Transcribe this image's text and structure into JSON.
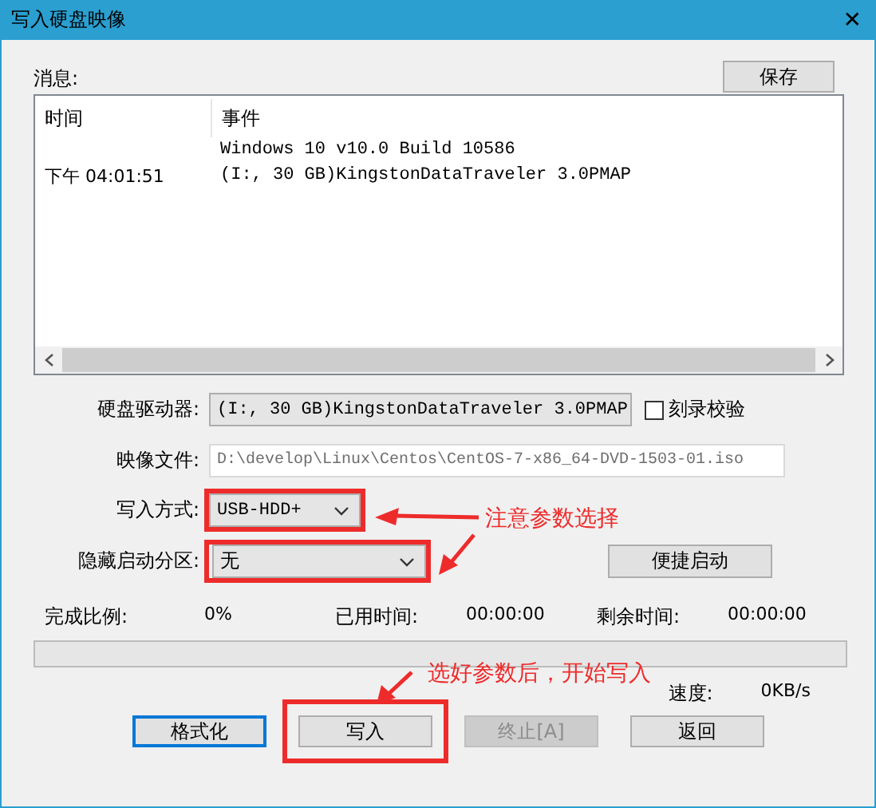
{
  "window": {
    "title": "写入硬盘映像",
    "close": "✕"
  },
  "messages": {
    "label": "消息:",
    "save_button": "保存",
    "columns": [
      "时间",
      "事件"
    ],
    "rows": [
      {
        "event": "Windows 10 v10.0 Build 10586"
      },
      {
        "time": "下午 04:01:51",
        "event": "(I:, 30 GB)KingstonDataTraveler 3.0PMAP"
      }
    ]
  },
  "form": [
    {
      "kind": "combo",
      "label": "硬盘驱动器:",
      "value": "(I:, 30 GB)KingstonDataTraveler 3.0PMAP",
      "checkbox": {
        "label": "刻录校验",
        "checked": false
      }
    },
    {
      "kind": "field",
      "label": "映像文件:",
      "value": "D:\\develop\\Linux\\Centos\\CentOS-7-x86_64-DVD-1503-01.iso"
    },
    {
      "kind": "combo",
      "label": "写入方式:",
      "value": "USB-HDD+",
      "highlighted": true
    },
    {
      "kind": "combo",
      "label": "隐藏启动分区:",
      "value": "无",
      "highlighted": true,
      "button": "便捷启动"
    }
  ],
  "progress": {
    "items": [
      {
        "label": "完成比例:",
        "value": "0%"
      },
      {
        "label": "已用时间:",
        "value": "00:00:00"
      },
      {
        "label": "剩余时间:",
        "value": "00:00:00"
      }
    ],
    "level": 0,
    "speed_label": "速度:",
    "speed": "0KB/s"
  },
  "buttons": [
    {
      "label": "格式化",
      "default": true,
      "disabled": false,
      "highlighted": false
    },
    {
      "label": "写入",
      "default": false,
      "disabled": false,
      "highlighted": true
    },
    {
      "label": "终止[A]",
      "default": false,
      "disabled": true,
      "highlighted": false
    },
    {
      "label": "返回",
      "default": false,
      "disabled": false,
      "highlighted": false
    }
  ],
  "annotations": [
    {
      "text": "注意参数选择"
    },
    {
      "text": "选好参数后，开始写入"
    }
  ]
}
